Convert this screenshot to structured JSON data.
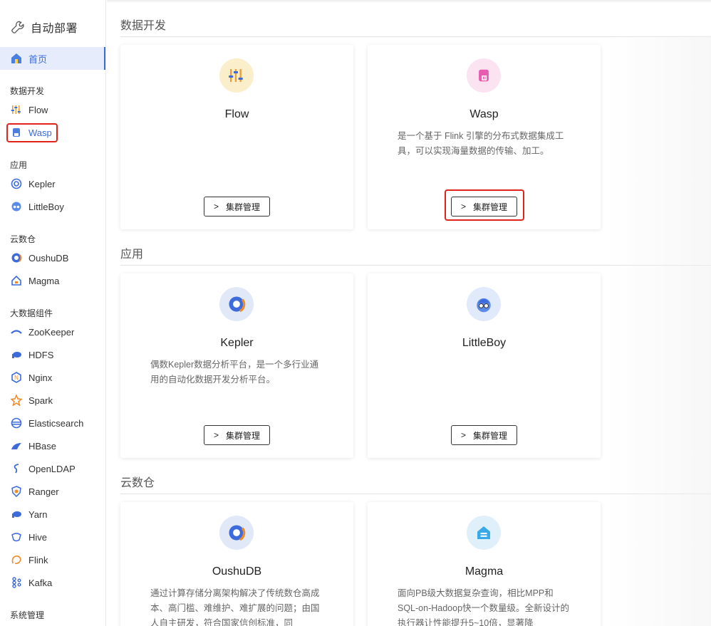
{
  "app": {
    "title": "自动部署"
  },
  "sidebar": {
    "home": {
      "label": "首页"
    },
    "groups": [
      {
        "title": "数据开发",
        "items": [
          "Flow",
          "Wasp"
        ]
      },
      {
        "title": "应用",
        "items": [
          "Kepler",
          "LittleBoy"
        ]
      },
      {
        "title": "云数仓",
        "items": [
          "OushuDB",
          "Magma"
        ]
      },
      {
        "title": "大数据组件",
        "items": [
          "ZooKeeper",
          "HDFS",
          "Nginx",
          "Spark",
          "Elasticsearch",
          "HBase",
          "OpenLDAP",
          "Ranger",
          "Yarn",
          "Hive",
          "Flink",
          "Kafka"
        ]
      },
      {
        "title": "系统管理",
        "items": []
      }
    ]
  },
  "sections": [
    {
      "title": "数据开发",
      "cards": [
        {
          "name": "Flow",
          "desc": "",
          "button": "集群管理",
          "icon": "sliders-icon"
        },
        {
          "name": "Wasp",
          "desc": "是一个基于 Flink 引擎的分布式数据集成工具，可以实现海量数据的传输、加工。",
          "button": "集群管理",
          "icon": "wasp-icon"
        }
      ]
    },
    {
      "title": "应用",
      "cards": [
        {
          "name": "Kepler",
          "desc": "偶数Kepler数据分析平台，是一个多行业通用的自动化数据开发分析平台。",
          "button": "集群管理",
          "icon": "kepler-icon"
        },
        {
          "name": "LittleBoy",
          "desc": "",
          "button": "集群管理",
          "icon": "littleboy-icon"
        }
      ]
    },
    {
      "title": "云数仓",
      "cards": [
        {
          "name": "OushuDB",
          "desc": "通过计算存储分离架构解决了传统数仓高成本、高门槛、难维护、难扩展的问题；由国人自主研发，符合国家信创标准，同",
          "icon": "oushudb-icon"
        },
        {
          "name": "Magma",
          "desc": "面向PB级大数据复杂查询，相比MPP和SQL-on-Hadoop快一个数量级。全新设计的执行器让性能提升5~10倍，显著降",
          "icon": "magma-icon"
        }
      ]
    }
  ],
  "colors": {
    "accent": "#3d6bdc",
    "highlight": "#e0241a"
  }
}
